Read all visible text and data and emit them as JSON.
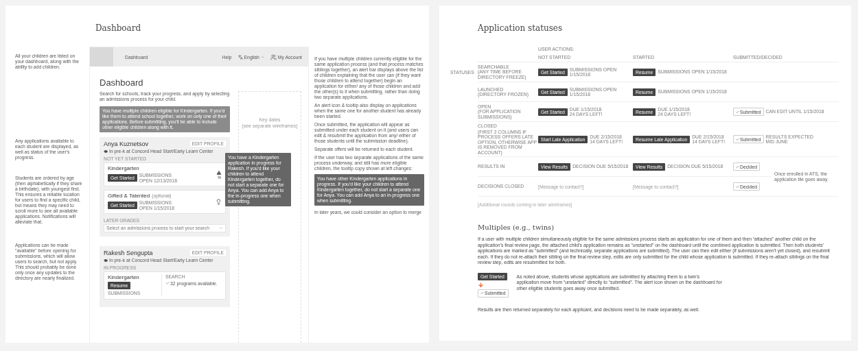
{
  "dashboard_page": {
    "title": "Dashboard",
    "notes": [
      "All your children are listed on your dashboard, along with the ability to add children.",
      "Any applications available to each student are displayed, as well as status of the user's progress.",
      "Students are ordered by age (then alphabetically if they share a birthdate), with youngest first. This ensures a reliable location for users to find a specific child, but means they may need to scroll more to see all available applications. Notifications will alleviate that.",
      "Applications can be made \"available\" before opening for submissions, which will allow users to search, but not apply. This should probably be done only once any updates to the directory are nearly finalized."
    ],
    "side_notes": [
      "If you have multiple children currently eligible for the same application process (and that process matches siblings together), an alert bar displays above the list of children explaining that the user can (if they want those children to attend together) begin an application for either/ any of those children and add the other(s) to it when submitting, rather than doing two separate applications.",
      "An alert icon & tooltip also display on applications when the same one for another student has already been started.",
      "Once submitted, the application will appear as submitted under each student on it (and users can edit & resubmit the application from any/ either of those students until the submission deadline).",
      "Separate offers will be returned to each student.",
      "If the user has two separate applications of the same process underway, and still has more eligible children, the tooltip copy shown at left changes:"
    ],
    "side_tooltip": "You have other Kindergarten applications in progress. If you'd like your children to attend Kindergarten together, do not start a separate one for Anya. You can add Anya to an in-progress one when submitting.",
    "side_tail": "In later years, we could consider an option to merge",
    "mockup": {
      "nav_title": "Dashboard",
      "nav_links": [
        {
          "kind": "text",
          "label": "Help"
        },
        {
          "kind": "language",
          "label": "English"
        },
        {
          "kind": "account",
          "label": "My Account"
        }
      ],
      "heading": "Dashboard",
      "intro": "Search for schools, track your progress, and apply by selecting an admissions process for your child.",
      "alert": "You have multiple children eligible for Kindergarten. If you'd like them to attend school together, work on only one of their applications. Before submitting, you'll be able to include other eligible children along with it.",
      "key_dates": [
        "Key dates",
        "(see separate wireframes)"
      ],
      "students": [
        {
          "name": "Anya Kuznetsov",
          "edit": "EDIT PROFILE",
          "school": "In pre-k at Concord Head Start/Early Learn Center",
          "section": "NOT YET STARTED",
          "apps": [
            {
              "title": "Kindergarten",
              "action": "Get Started",
              "note": "SUBMISSIONS\nOPEN 12/13/2018",
              "alert": true,
              "idea": false,
              "tooltip": "You have a Kindergarten application in progress for Rakesh. If you'd like your children to attend Kindergarten together, do not start a separate one for Anya. You can add Anya to the in-progress one when submitting."
            },
            {
              "title": "Gifted & Talented",
              "optional": "(optional)",
              "action": "Get Started",
              "note": "SUBMISSIONS\nOPEN 1/15/2018",
              "alert": false,
              "idea": true
            }
          ],
          "later": {
            "heading": "LATER GRADES",
            "placeholder": "Select an admissions process to start your search"
          }
        },
        {
          "name": "Rakesh Sengupta",
          "edit": "EDIT PROFILE",
          "school": "In pre-k at Concord Head Start/Early Learn Center",
          "section": "IN PROGRESS",
          "apps": [
            {
              "title": "Kindergarten",
              "action": "Resume",
              "note": "SUBMISSIONS",
              "alert": false,
              "idea": false,
              "search": {
                "heading": "SEARCH",
                "text": "32 programs available."
              }
            }
          ]
        }
      ]
    }
  },
  "statuses_page": {
    "title": "Application statuses",
    "group_label": "USER ACTIONS:",
    "row_label": "STATUSES",
    "columns": [
      "NOT STARTED",
      "STARTED",
      "SUBMITTED/DECIDED"
    ],
    "rows": [
      {
        "status": "SEARCHABLE\n(ANY TIME BEFORE\nDIRECTORY FREEZE)",
        "not_started": {
          "kind": "button",
          "label": "Get Started",
          "note": "SUBMISSIONS OPEN 1/15/2018"
        },
        "started": {
          "kind": "button",
          "label": "Resume",
          "note": "SUBMISSIONS OPEN 1/15/2018"
        }
      },
      {
        "status": "LAUNCHED\n(DIRECTORY FROZEN)",
        "not_started": {
          "kind": "button",
          "label": "Get Started",
          "note": "SUBMISSIONS OPEN 1/15/2018"
        },
        "started": {
          "kind": "button",
          "label": "Resume",
          "note": "SUBMISSIONS OPEN 1/15/2018"
        }
      },
      {
        "status": "OPEN\n(FOR APPLICATION\nSUBMISSIONS)",
        "not_started": {
          "kind": "button",
          "label": "Get Started",
          "note": "DUE 1/15/2018\n24 DAYS LEFT!"
        },
        "started": {
          "kind": "button",
          "label": "Resume",
          "note": "DUE 1/15/2018\n24 DAYS LEFT!"
        },
        "done": {
          "kind": "badge",
          "label": "Submitted",
          "note": "CAN EDIT UNTIL 1/15/2018"
        }
      },
      {
        "status": "CLOSED",
        "status_detail": "(FIRST 2 COLUMNS IF PROCESS OFFERS LATE OPTION, OTHERWISE APP IS REMOVED FROM ACCOUNT)",
        "not_started": {
          "kind": "button",
          "label": "Start Late Application",
          "note": "DUE 2/15/2018\n14 DAYS LEFT!"
        },
        "started": {
          "kind": "button",
          "label": "Resume Late Application",
          "note": "DUE 2/15/2018\n14 DAYS LEFT!"
        },
        "done": {
          "kind": "badge",
          "label": "Submitted",
          "note": "RESULTS EXPECTED\nMID JUNE"
        }
      },
      {
        "status": "RESULTS IN",
        "not_started": {
          "kind": "button",
          "label": "View Results",
          "note": "DECISION DUE 5/15/2018"
        },
        "started": {
          "kind": "button",
          "label": "View Results",
          "note": "DECISION DUE 5/15/2018"
        },
        "done": {
          "kind": "badge",
          "label": "Decided"
        }
      },
      {
        "status": "DECISIONS CLOSED",
        "not_started": {
          "kind": "message",
          "label": "[Message to contact?]"
        },
        "started": {
          "kind": "message",
          "label": "[Message to contact?]"
        },
        "done": {
          "kind": "badge",
          "label": "Decided"
        }
      }
    ],
    "side_note": "Once enrolled in ATS, the application tile goes away.",
    "footer": "[Additional rounds coming in later wireframes]",
    "multiples": {
      "title": "Multiples (e.g., twins)",
      "text": "If a user with multiple children simultaneously eligible for the same admissions process starts an application for one of them and then “attaches” another child on the application’s final review page, the attached child’s application remains as “unstarted” on the dashboard until the combined application is submitted. Then both students’ applications are marked as “submitted” (and technically, separate applications are submitted). The user can then edit either (if submissions aren’t yet closed), and resubmit each. If they do not re-attach their sibling on the final review step, edits are only submitted for the child whose application is submitted. If they re-attach siblings on the final review step, edits are resubmitted for both.",
      "from": "Get Started",
      "to": "Submitted",
      "example_note": "As noted above, students whose applications are submitted by attaching them to a twin’s application move from “unstarted” directly to “submitted”. The alert icon shown on the dashboard for other eligible students goes away once submitted.",
      "closing": "Results are then returned separately for each applicant, and decisions need to be made separately, as well."
    }
  }
}
